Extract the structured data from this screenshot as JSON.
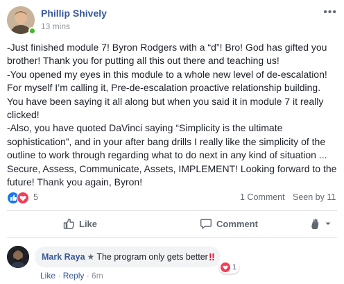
{
  "post": {
    "author": "Phillip Shively",
    "time": "13 mins",
    "more_label": "•••",
    "paragraphs": [
      "-Just finished module 7! Byron Rodgers with a “d”! Bro! God has gifted you brother! Thank you for putting all this out there and teaching us!",
      "-You opened my eyes in this module to a whole new level of de-escalation! For myself I’m calling it, Pre-de-escalation proactive relationship building. You have been saying it all along but when you said it in module 7 it really clicked!",
      "-Also, you have quoted DaVinci saying “Simplicity is the ultimate sophistication”, and in your after bang drills I really like the simplicity of the outline to work through regarding what to do next in any kind of situation ... Secure, Assess, Communicate, Assets, IMPLEMENT! Looking forward to the future! Thank you again, Byron!"
    ]
  },
  "stats": {
    "reaction_count": "5",
    "comments": "1 Comment",
    "seen_by": "Seen by 11"
  },
  "actions": {
    "like": "Like",
    "comment": "Comment"
  },
  "comment": {
    "author": "Mark Raya",
    "text": "The program only gets better",
    "emphasis": "‼",
    "reaction_count": "1",
    "like": "Like",
    "separator": " · ",
    "reply": "Reply",
    "age": "6m"
  },
  "colors": {
    "link_blue": "#365899",
    "like_blue": "#1877f2",
    "love_red": "#f33e58",
    "presence_green": "#42b72a",
    "meta_gray": "#606770"
  }
}
